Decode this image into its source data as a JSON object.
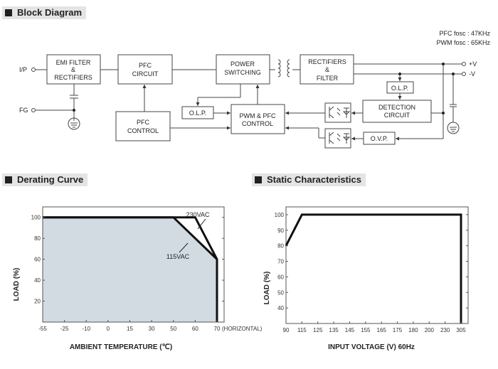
{
  "sections": {
    "block_diagram": "Block Diagram",
    "derating_curve": "Derating Curve",
    "static_characteristics": "Static Characteristics"
  },
  "block_diagram": {
    "freq_notes": [
      "PFC fosc : 47KHz",
      "PWM fosc : 65KHz"
    ],
    "terminals": {
      "input": "I/P",
      "fg": "FG",
      "vplus": "+V",
      "vminus": "-V"
    },
    "blocks": {
      "emi": [
        "EMI FILTER",
        "&",
        "RECTIFIERS"
      ],
      "pfc_circuit": [
        "PFC",
        "CIRCUIT"
      ],
      "power_switching": [
        "POWER",
        "SWITCHING"
      ],
      "rect_filter": [
        "RECTIFIERS",
        "&",
        "FILTER"
      ],
      "pfc_control": [
        "PFC",
        "CONTROL"
      ],
      "pwm_pfc_control": [
        "PWM & PFC",
        "CONTROL"
      ],
      "olp_left": "O.L.P.",
      "olp_right": "O.L.P.",
      "detection": [
        "DETECTION",
        "CIRCUIT"
      ],
      "ovp": "O.V.P."
    }
  },
  "chart_data": [
    {
      "type": "area",
      "title": "Derating Curve",
      "xlabel": "AMBIENT TEMPERATURE (℃)",
      "ylabel": "LOAD (%)",
      "x_ticks": [
        "-55",
        "-25",
        "-10",
        "0",
        "15",
        "30",
        "50",
        "60",
        "70"
      ],
      "x_suffix": "(HORIZONTAL)",
      "y_ticks": [
        20,
        40,
        60,
        80,
        100
      ],
      "ylim": [
        0,
        110
      ],
      "series": [
        {
          "name": "115VAC",
          "points": [
            [
              -55,
              100
            ],
            [
              50,
              100
            ],
            [
              70,
              60
            ],
            [
              70,
              0
            ]
          ],
          "filled": true
        },
        {
          "name": "230VAC",
          "points": [
            [
              -55,
              100
            ],
            [
              60,
              100
            ],
            [
              70,
              60
            ],
            [
              70,
              0
            ]
          ],
          "filled": false
        }
      ],
      "annotations": [
        "230VAC",
        "115VAC"
      ],
      "fill_color": "#d3dbe2"
    },
    {
      "type": "line",
      "title": "Static Characteristics",
      "xlabel": "INPUT VOLTAGE (V) 60Hz",
      "ylabel": "LOAD (%)",
      "x_ticks": [
        "90",
        "115",
        "125",
        "135",
        "145",
        "155",
        "165",
        "175",
        "180",
        "200",
        "230",
        "305"
      ],
      "y_ticks": [
        40,
        50,
        60,
        70,
        80,
        90,
        100
      ],
      "ylim": [
        30,
        105
      ],
      "series": [
        {
          "name": "Load",
          "points": [
            [
              "90",
              80
            ],
            [
              "115",
              100
            ],
            [
              "305",
              100
            ],
            [
              "305",
              30
            ]
          ]
        }
      ]
    }
  ]
}
